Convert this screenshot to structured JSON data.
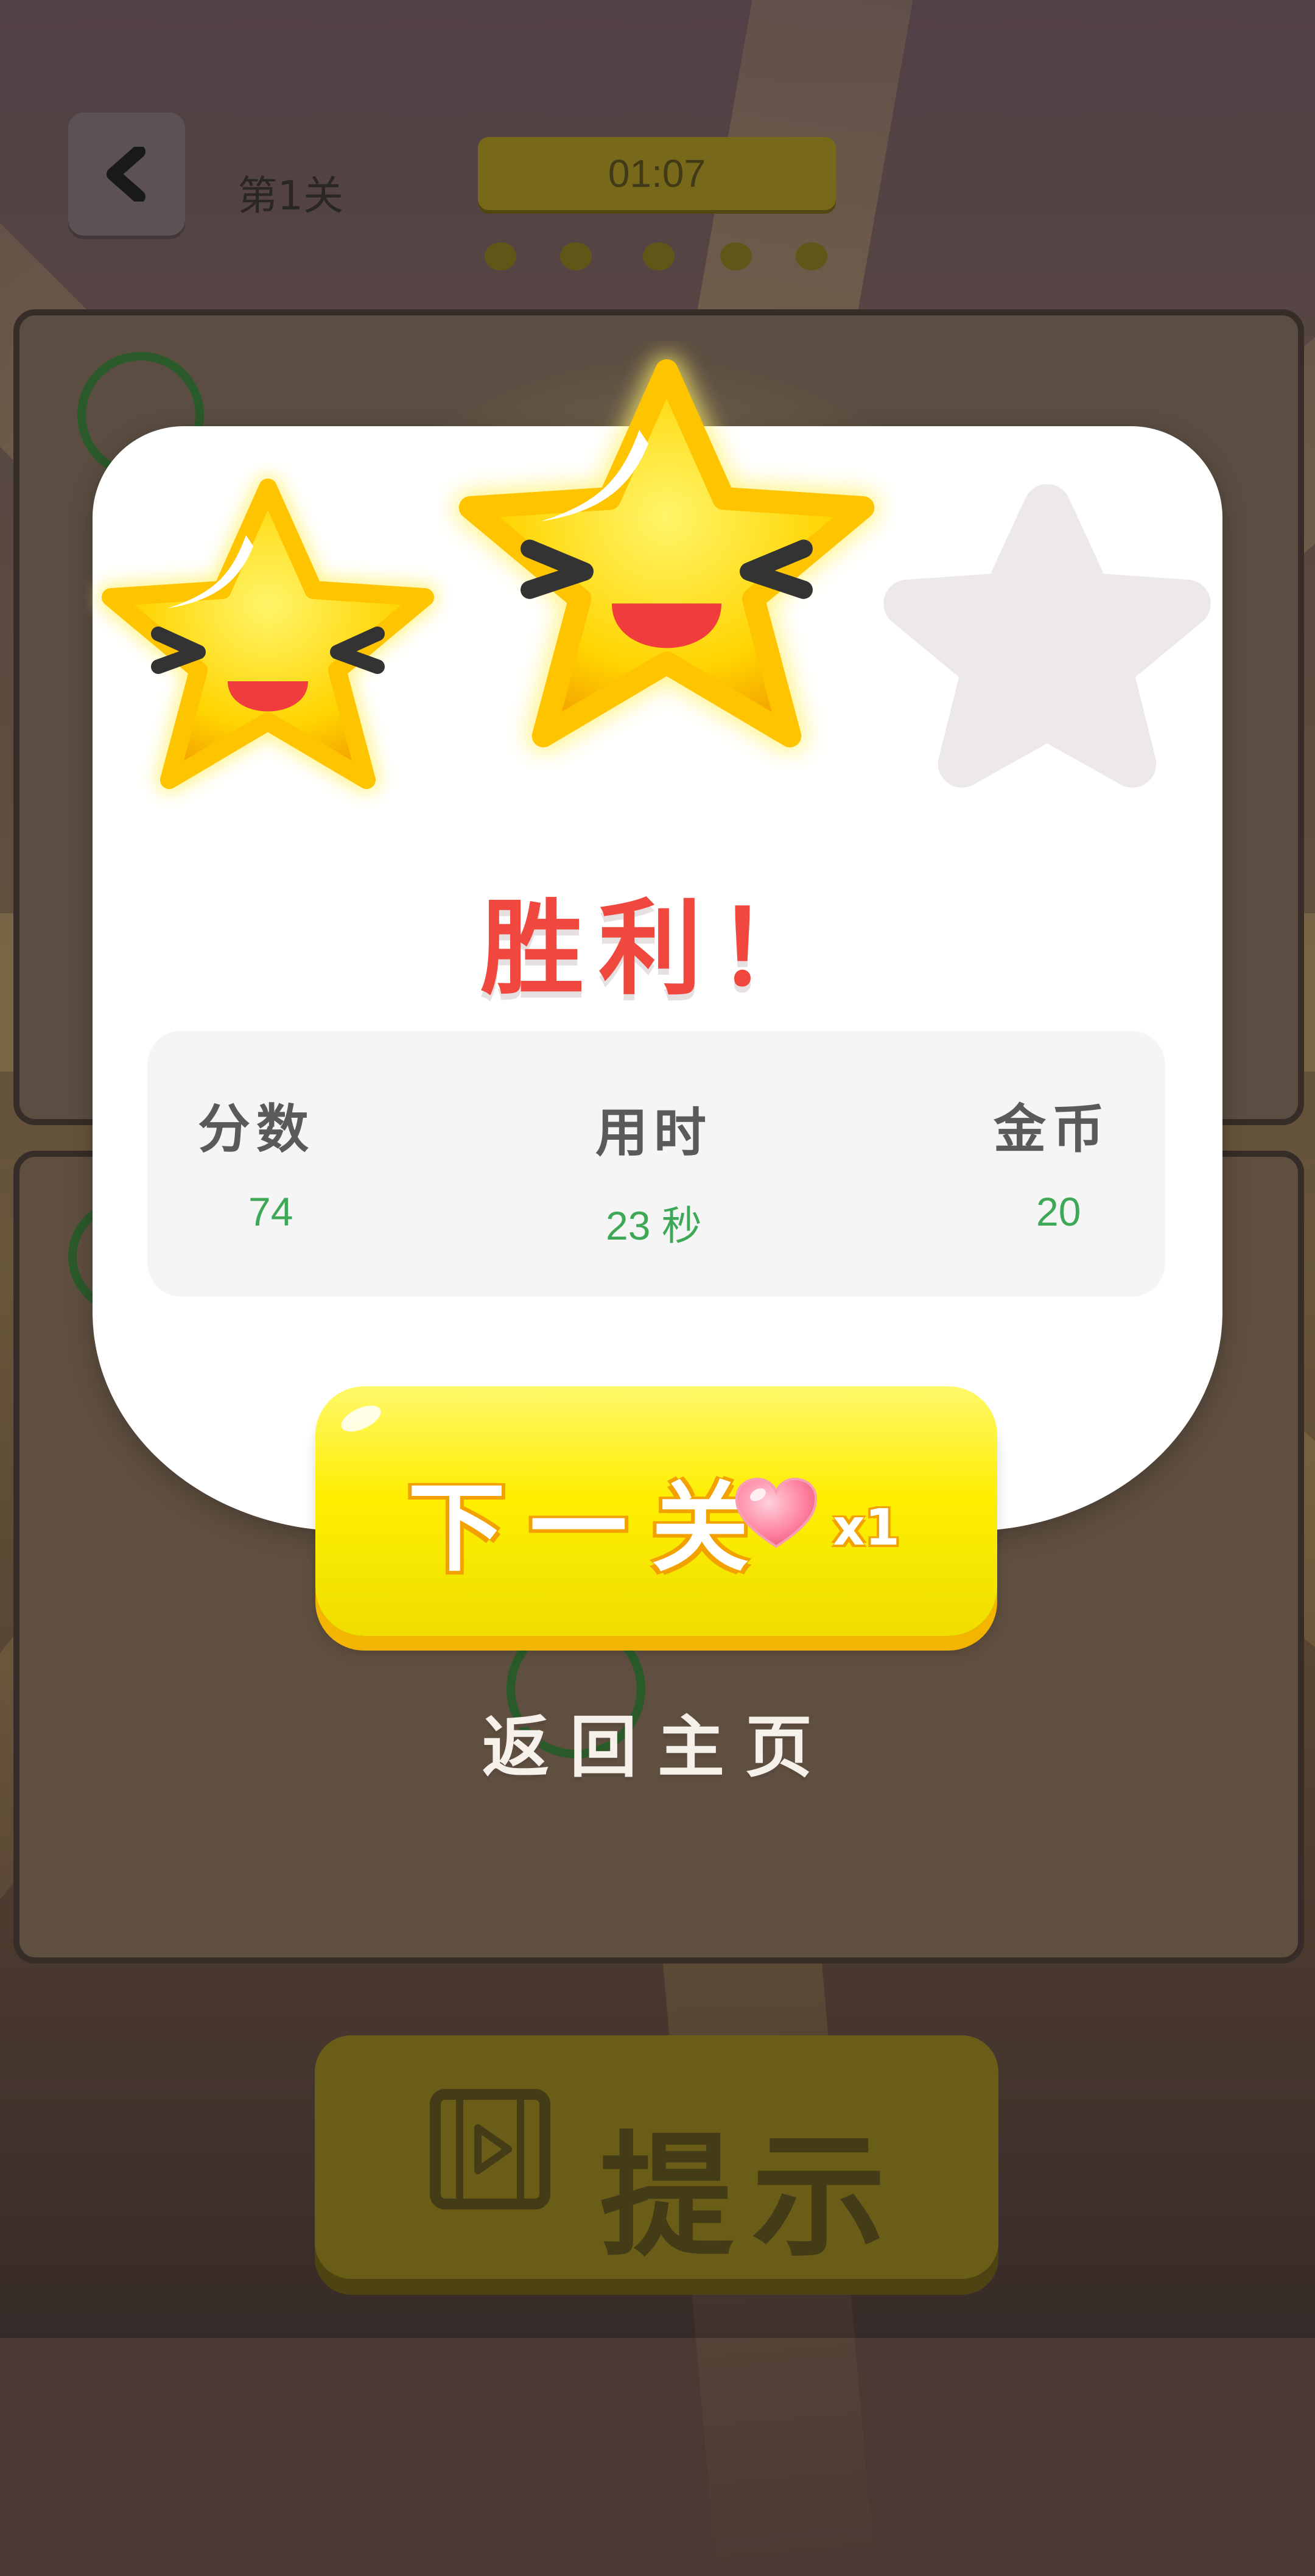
{
  "topbar": {
    "level_label": "第1关",
    "timer": "01:07",
    "progress_dots": 5
  },
  "dialog": {
    "stars_earned": 2,
    "stars_total": 3,
    "title": "胜利！",
    "stats": {
      "score_label": "分数",
      "score_value": "74",
      "time_label": "用时",
      "time_value": "23 秒",
      "coins_label": "金币",
      "coins_value": "20"
    },
    "next_button": {
      "label": "下一关",
      "cost": "x1"
    },
    "home_link": "返回主页"
  },
  "hint_button": {
    "label": "提示"
  },
  "colors": {
    "title_red": "#f0483e",
    "stat_green": "#3ea856",
    "button_yellow": "#ffee00",
    "button_shadow": "#f3b500"
  }
}
